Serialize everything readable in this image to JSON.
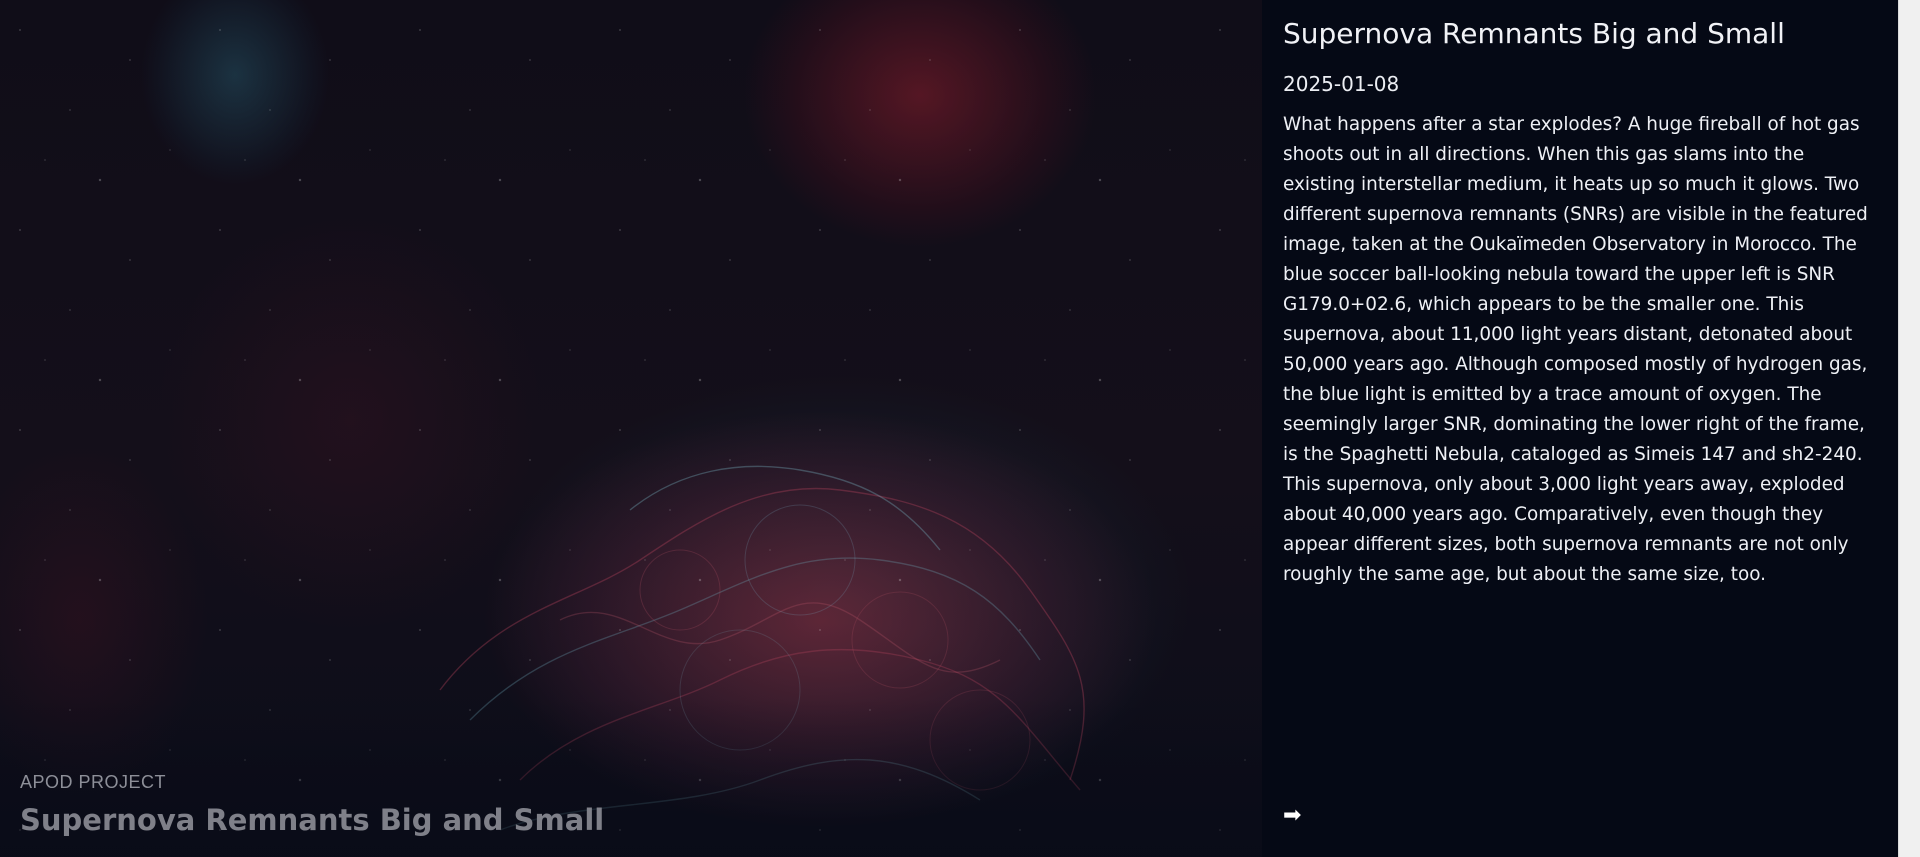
{
  "hero": {
    "kicker": "APOD PROJECT",
    "title": "Supernova Remnants Big and Small"
  },
  "panel": {
    "title": "Supernova Remnants Big and Small",
    "date": "2025-01-08",
    "description": "What happens after a star explodes? A huge fireball of hot gas shoots out in all directions. When this gas slams into the existing interstellar medium, it heats up so much it glows. Two different supernova remnants (SNRs) are visible in the featured image, taken at the Oukaïmeden Observatory in Morocco. The blue soccer ball-looking nebula toward the upper left is SNR G179.0+02.6, which appears to be the smaller one. This supernova, about 11,000 light years distant, detonated about 50,000 years ago. Although composed mostly of hydrogen gas, the blue light is emitted by a trace amount of oxygen. The seemingly larger SNR, dominating the lower right of the frame, is the Spaghetti Nebula, cataloged as Simeis 147 and sh2-240. This supernova, only about 3,000 light years away, exploded about 40,000 years ago. Comparatively, even though they appear different sizes, both supernova remnants are not only roughly the same age, but about the same size, too.",
    "next_icon": "arrow-right-icon",
    "next_glyph": "➡"
  },
  "colors": {
    "background": "#050915",
    "text": "#f2f3f7",
    "caption": "#7f8089"
  }
}
